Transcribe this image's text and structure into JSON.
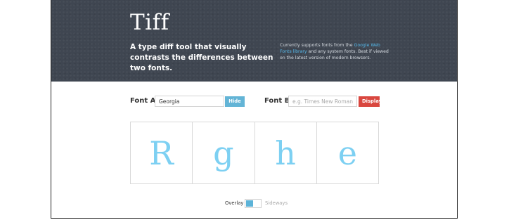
{
  "hero": {
    "title": "Tiff",
    "tagline": "A type diff tool that visually contrasts the differences between two fonts.",
    "note_before": "Currently supports fonts from the ",
    "note_link": "Google Web Fonts library",
    "note_after": " and any system fonts. Best if viewed on the latest version of modern browsers."
  },
  "form": {
    "font_a_label": "Font A",
    "font_a_value": "Georgia",
    "hide_label": "Hide",
    "font_b_label": "Font B",
    "font_b_placeholder": "e.g. Times New Roman",
    "display_label": "Display"
  },
  "glyphs": [
    "R",
    "g",
    "h",
    "e"
  ],
  "colors": {
    "hero_background": "#3f4651",
    "link": "#55b7e8",
    "glyph": "#7dd0f2",
    "hide_button": "#63b4d6",
    "display_button": "#d9473f"
  },
  "view_mode": {
    "overlay_label": "Overlay",
    "sideways_label": "Sideways",
    "selected": "Overlay"
  }
}
